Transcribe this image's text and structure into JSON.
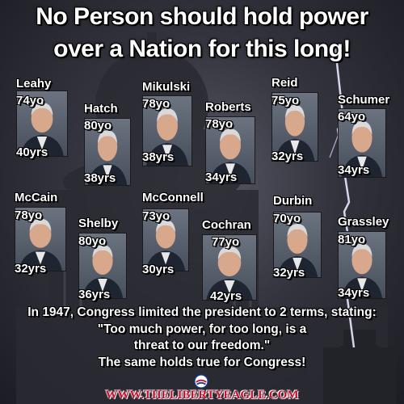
{
  "title": {
    "line1": "No Person should hold power",
    "line2": "over a Nation for this long!"
  },
  "senators": [
    {
      "name": "Leahy",
      "age": "74yo",
      "years": "40yrs"
    },
    {
      "name": "Hatch",
      "age": "80yo",
      "years": "38yrs"
    },
    {
      "name": "Mikulski",
      "age": "78yo",
      "years": "38yrs"
    },
    {
      "name": "Roberts",
      "age": "78yo",
      "years": "34yrs"
    },
    {
      "name": "Reid",
      "age": "75yo",
      "years": "32yrs"
    },
    {
      "name": "Schumer",
      "age": "64yo",
      "years": "34yrs"
    },
    {
      "name": "McCain",
      "age": "78yo",
      "years": "32yrs"
    },
    {
      "name": "Shelby",
      "age": "80yo",
      "years": "36yrs"
    },
    {
      "name": "McConnell",
      "age": "73yo",
      "years": "30yrs"
    },
    {
      "name": "Cochran",
      "age": "77yo",
      "years": "42yrs"
    },
    {
      "name": "Durbin",
      "age": "70yo",
      "years": "32yrs"
    },
    {
      "name": "Grassley",
      "age": "81yo",
      "years": "34yrs"
    }
  ],
  "footer": {
    "line1": "In 1947, Congress limited the president to 2 terms, stating:",
    "line2": "\"Too much power, for too long, is a",
    "line3": "threat to our freedom.\"",
    "line4": "The same holds true for Congress!"
  },
  "website": "WWW.THELIBERTYEAGLE.COM",
  "colors": {
    "text": "#ffffff",
    "url": "#c8102e",
    "background": "#34343e"
  }
}
